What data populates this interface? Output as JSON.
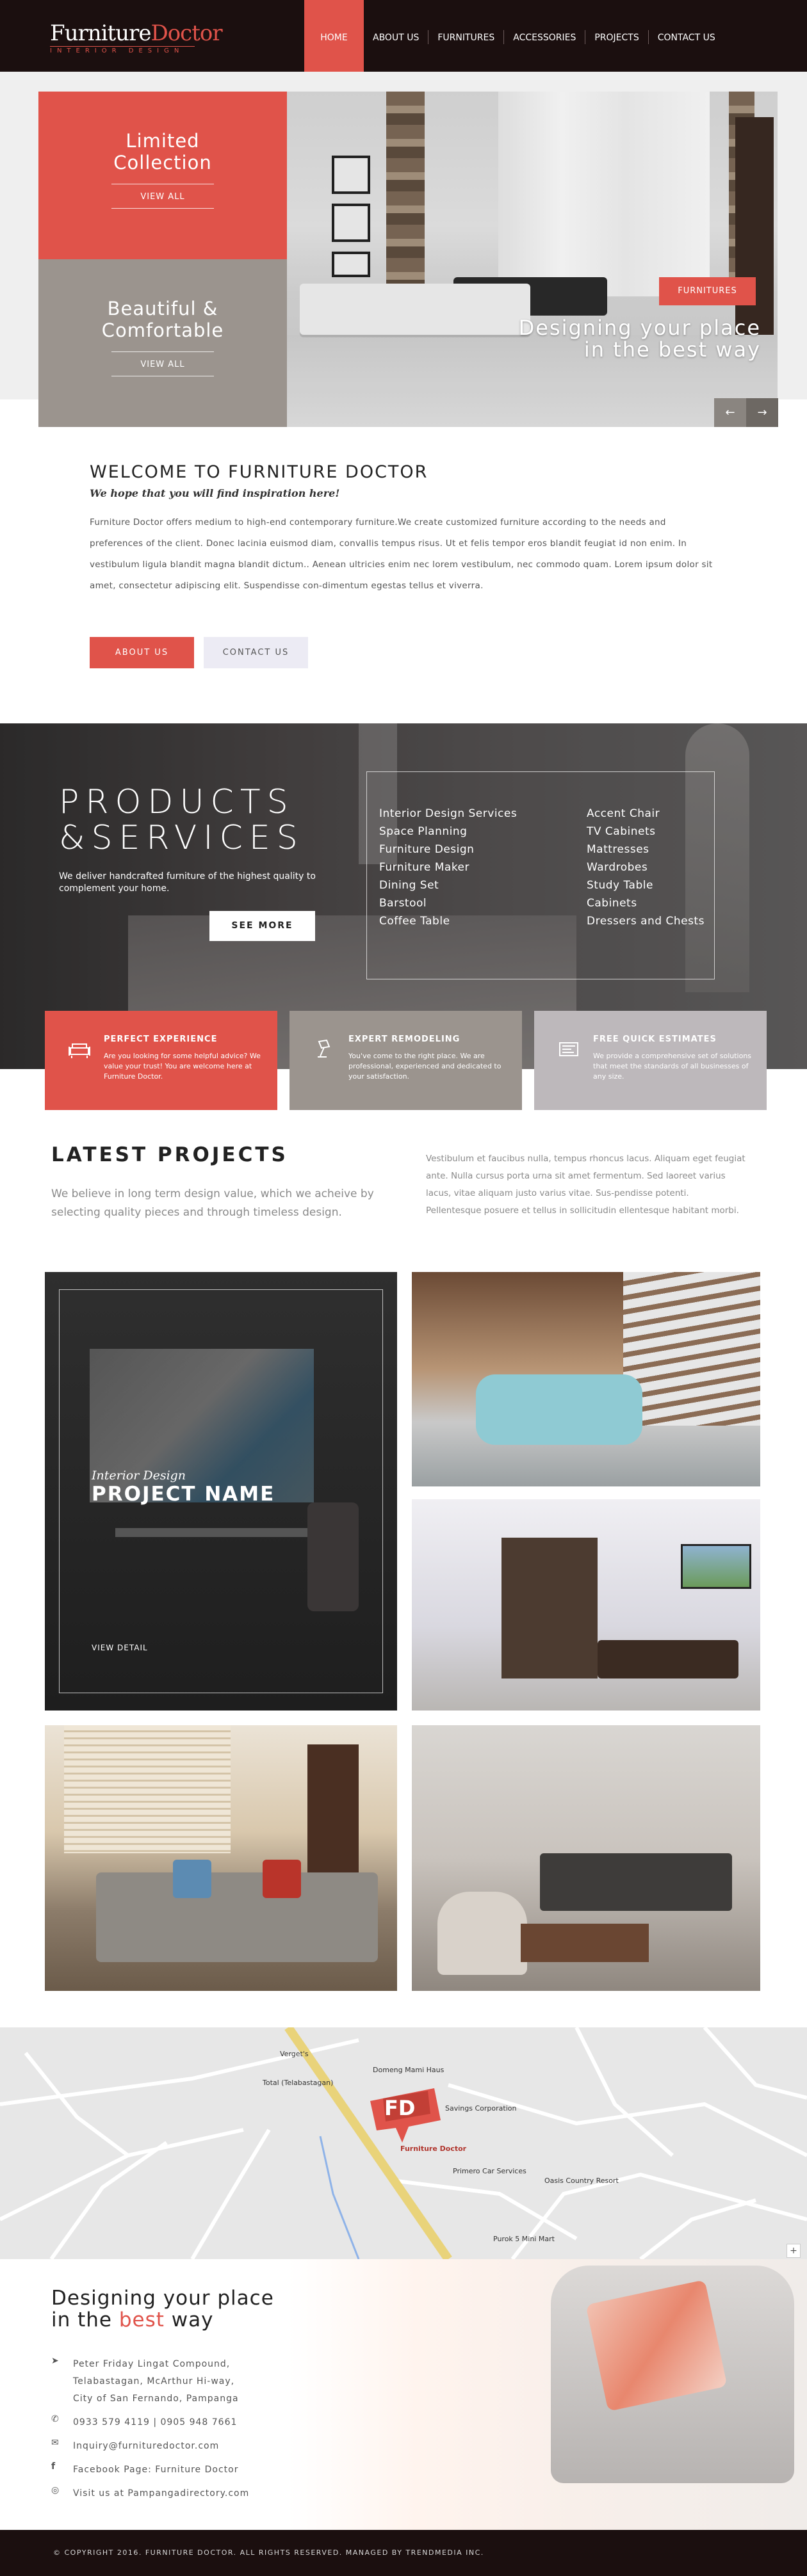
{
  "header": {
    "logo_main_a": "Furniture",
    "logo_main_b": "Doctor",
    "logo_sub": "INTERIOR DESIGN",
    "nav": [
      "HOME",
      "ABOUT US",
      "FURNITURES",
      "ACCESSORIES",
      "PROJECTS",
      "CONTACT US"
    ],
    "active_index": 0
  },
  "hero": {
    "promo_1_title_a": "Limited",
    "promo_1_title_b": "Collection",
    "promo_1_link": "VIEW ALL",
    "promo_2_title_a": "Beautiful &",
    "promo_2_title_b": "Comfortable",
    "promo_2_link": "VIEW ALL",
    "tag": "FURNITURES",
    "caption_a": "Designing your place",
    "caption_b": "in the best way",
    "prev_icon": "arrow-left-icon",
    "next_icon": "arrow-right-icon"
  },
  "welcome": {
    "title": "WELCOME TO FURNITURE DOCTOR",
    "subtitle": "We hope that you will find inspiration here!",
    "text": "Furniture Doctor offers medium to high-end contemporary furniture.We create customized furniture according to the needs and preferences of the client. Donec lacinia euismod diam, convallis tempus risus. Ut et felis tempor eros blandit feugiat id non enim. In vestibulum ligula blandit magna blandit dictum.. Aenean ultricies enim nec lorem vestibulum, nec commodo quam. Lorem ipsum dolor sit amet, consectetur adipiscing elit. Suspendisse con-dimentum egestas tellus et viverra.",
    "btn_about": "ABOUT US",
    "btn_contact": "CONTACT US"
  },
  "services": {
    "heading_a": "PRODUCTS",
    "heading_b": "&SERVICES",
    "desc": "We deliver handcrafted furniture of the highest quality to complement your home.",
    "btn_more": "SEE MORE",
    "col_1": [
      "Interior Design Services",
      "Space Planning",
      "Furniture Design",
      "Furniture Maker",
      "Dining Set",
      "Barstool",
      "Coffee Table"
    ],
    "col_2": [
      "Accent Chair",
      "TV Cabinets",
      "Mattresses",
      "Wardrobes",
      "Study Table",
      "Cabinets",
      "Dressers and Chests"
    ]
  },
  "features": [
    {
      "icon": "sofa-icon",
      "title": "PERFECT EXPERIENCE",
      "text": "Are you looking for some helpful advice? We value your trust! You are welcome here at Furniture Doctor."
    },
    {
      "icon": "lamp-icon",
      "title": "EXPERT REMODELING",
      "text": "You've come to the right place. We are professional, experienced and dedicated to your satisfaction."
    },
    {
      "icon": "estimate-icon",
      "title": "FREE QUICK ESTIMATES",
      "text": "We provide a comprehensive set of solutions that meet the standards of all businesses of any size."
    }
  ],
  "projects": {
    "title": "LATEST PROJECTS",
    "intro": "We believe in long term design value, which we acheive by selecting quality pieces and through timeless design.",
    "text": "Vestibulum et faucibus nulla, tempus rhoncus lacus. Aliquam eget feugiat ante. Nulla cursus porta urna sit amet fermentum. Sed laoreet varius lacus, vitae aliquam justo varius vitae. Sus-pendisse potenti. Pellentesque posuere et tellus in sollicitudin ellentesque habitant morbi.",
    "feature_sub": "Interior Design",
    "feature_name": "PROJECT NAME",
    "feature_link": "VIEW DETAIL"
  },
  "map": {
    "labels": [
      "Verget's",
      "Total (Telabastagan)",
      "Domeng Mami Haus",
      "Savings Corporation",
      "Furniture Doctor",
      "Primero Car Services",
      "Oasis Country Resort",
      "Purok 5 Mini Mart"
    ],
    "pin_text": "FD",
    "zoom": "+"
  },
  "contact": {
    "title_a": "Designing your place",
    "title_b_pre": "in the ",
    "title_b_red": "best",
    "title_b_post": " way",
    "address_1": "Peter Friday Lingat Compound,",
    "address_2": "Telabastagan, McArthur Hi-way,",
    "address_3": "City of San Fernando, Pampanga",
    "phone": "0933 579 4119 | 0905 948 7661",
    "email": "Inquiry@furnituredoctor.com",
    "facebook": "Facebook Page: Furniture Doctor",
    "website": "Visit us at Pampangadirectory.com"
  },
  "footer": {
    "copyright": "© COPYRIGHT 2016. FURNITURE DOCTOR. ALL RIGHTS RESERVED. MANAGED BY TRENDMEDIA INC."
  }
}
